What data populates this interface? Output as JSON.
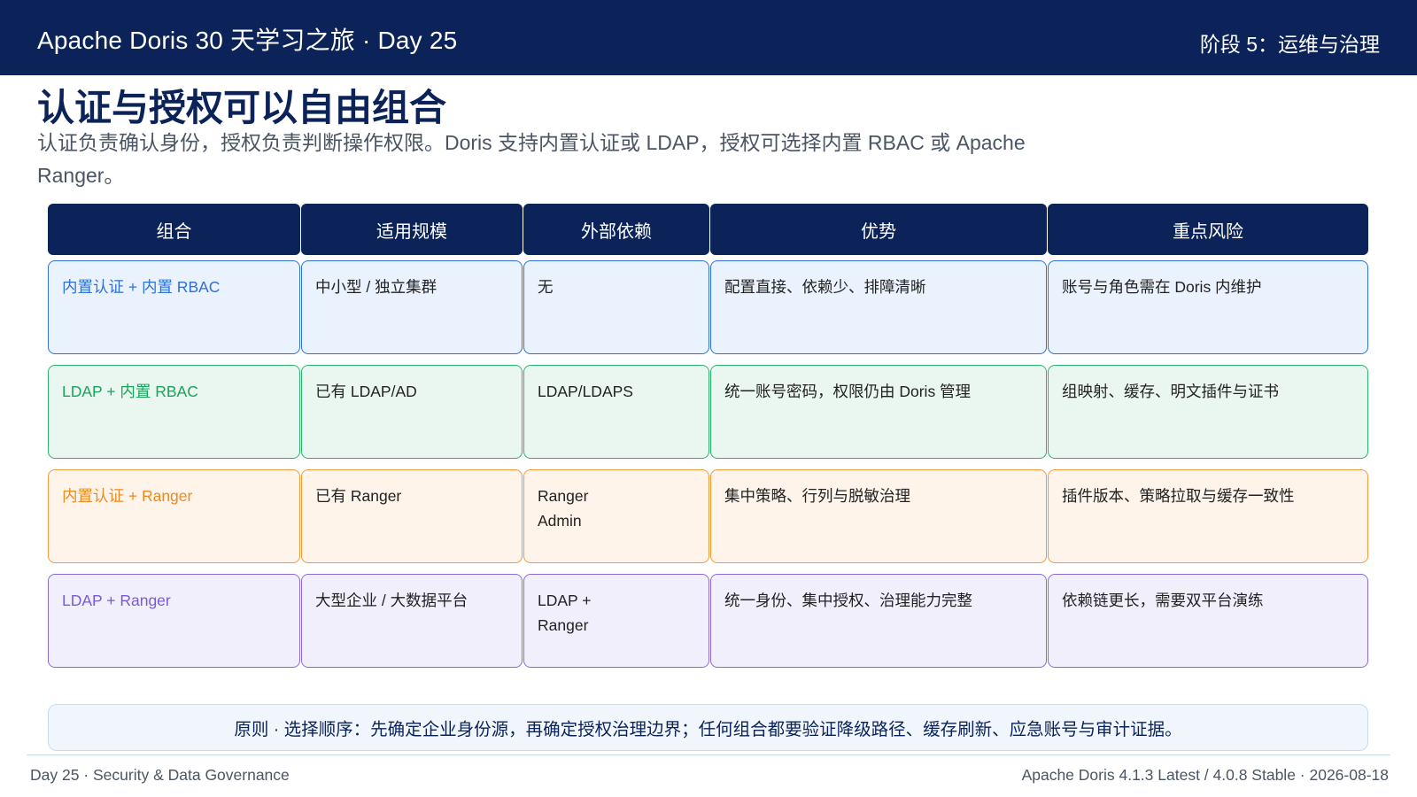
{
  "header": {
    "title": "Apache Doris 30 天学习之旅  ·  Day 25",
    "stage": "阶段 5：运维与治理"
  },
  "page_title": "认证与授权可以自由组合",
  "subtitle": "认证负责确认身份，授权负责判断操作权限。Doris 支持内置认证或 LDAP，授权可选择内置 RBAC 或 Apache Ranger。",
  "table": {
    "columns": [
      "组合",
      "适用规模",
      "外部依赖",
      "优势",
      "重点风险"
    ],
    "rows": [
      {
        "cells": [
          "内置认证 + 内置 RBAC",
          "中小型 / 独立集群",
          "无",
          "配置直接、依赖少、排障清晰",
          "账号与角色需在 Doris 内维护"
        ],
        "accent": "#2f6fd6",
        "border": "#2f6fd6",
        "fill": "#eaf3fd"
      },
      {
        "cells": [
          "LDAP + 内置 RBAC",
          "已有 LDAP/AD",
          "LDAP/LDAPS",
          "统一账号密码，权限仍由 Doris 管理",
          "组映射、缓存、明文插件与证书"
        ],
        "accent": "#1aa35a",
        "border": "#2bb36a",
        "fill": "#eaf7f0"
      },
      {
        "cells": [
          "内置认证 + Ranger",
          "已有 Ranger",
          "Ranger\nAdmin",
          "集中策略、行列与脱敏治理",
          "插件版本、策略拉取与缓存一致性"
        ],
        "accent": "#ec8a22",
        "border": "#f09a3c",
        "fill": "#fef4ea"
      },
      {
        "cells": [
          "LDAP + Ranger",
          "大型企业 / 大数据平台",
          "LDAP +\nRanger",
          "统一身份、集中授权、治理能力完整",
          "依赖链更长，需要双平台演练"
        ],
        "accent": "#7a5ad6",
        "border": "#8a6ad8",
        "fill": "#f2effd"
      }
    ]
  },
  "note": "原则  ·  选择顺序：先确定企业身份源，再确定授权治理边界；任何组合都要验证降级路径、缓存刷新、应急账号与审计证据。",
  "footer": {
    "left": "Day 25  ·  Security & Data Governance",
    "right": "Apache Doris 4.1.3 Latest / 4.0.8 Stable  ·  2026-08-18"
  }
}
